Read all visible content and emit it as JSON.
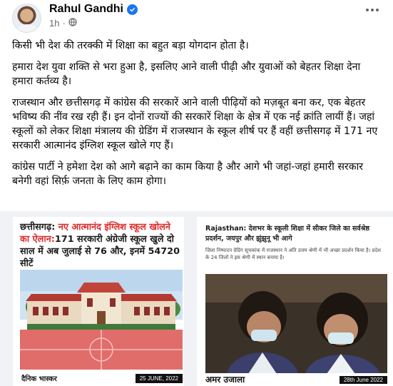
{
  "post": {
    "author": "Rahul Gandhi",
    "time": "1h",
    "more_icon": "more-horizontal-icon",
    "verified_icon": "verified-badge-icon",
    "privacy_icon": "globe-icon",
    "paragraphs": [
      "किसी भी देश की तरक्की में शिक्षा का बहुत बड़ा योगदान होता है।",
      "हमारा देश युवा शक्ति से भरा हुआ है, इसलिए आने वाली पीढ़ी और युवाओं को बेहतर शिक्षा देना हमारा कर्तव्य है।",
      "राजस्थान और छत्तीसगढ़ में कांग्रेस की सरकारें आने वाली पीढ़ियों को मज़बूत बना कर, एक बेहतर भविष्य की नींव रख रही हैं। इन दोनों राज्यों की सरकारें शिक्षा के क्षेत्र में एक नई क्रांति लायीं हैं। जहां स्कूलों को लेकर शिक्षा मंत्रालय की ग्रेडिंग में राजस्थान के स्कूल शीर्ष पर हैं वहीं छत्तीसगढ़ में 171 नए सरकारी आत्मानंद इंग्लिश स्कूल खोले गए हैं।",
      "कांग्रेस पार्टी ने हमेशा देश को आगे बढ़ाने का काम किया है और आगे भी जहां-जहां हमारी सरकार बनेगी वहां सिर्फ़ जनता के लिए काम होगा।"
    ]
  },
  "media": {
    "left": {
      "headline_prefix": "छत्तीसगढ़: ",
      "headline_red": "नए आत्मानंद इंग्लिश स्कूल खोलने का ऐलान:",
      "headline_rest": "171 सरकारी अंग्रेजी स्कूल खुले दो साल में अब जुलाई से 76 और, इनमें 54720 सीटें",
      "brand": "दैनिक भास्कर",
      "date": "25 JUNE, 2022"
    },
    "right": {
      "label": "Rajasthan: ",
      "headline": "देशभर के स्कूली शिक्षा में सीकर जिले का सर्वश्रेष्ठ प्रदर्शन, जयपुर और झुंझुनू भी आगे",
      "subtext": "जिला निष्पादन ग्रेडिंग सूचकांक में राजस्थान ने अति उत्तम श्रेणी में भी अच्छा प्रदर्शन किया है। प्रदेश के 24 जिलों ने इस श्रेणी में स्थान बनाया है।",
      "brand": "अमर उजाला",
      "date": "28th June 2022"
    }
  },
  "colors": {
    "verified": "#1877f2",
    "secondary_text": "#65676b",
    "headline_red": "#e02a2a",
    "media_bg": "#f0f2f5"
  }
}
